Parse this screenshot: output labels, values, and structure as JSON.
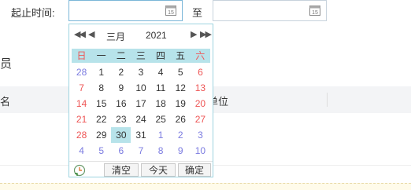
{
  "range_label": "起止时间:",
  "to_label": "至",
  "behind": {
    "section_text": "员",
    "col1": "名",
    "col2": "单位"
  },
  "calendar": {
    "nav_prev_year": "◀◀",
    "nav_prev_month": "◀",
    "nav_next_month": "▶",
    "nav_next_year": "▶▶",
    "month": "三月",
    "year": "2021",
    "weekdays": [
      "日",
      "一",
      "二",
      "三",
      "四",
      "五",
      "六"
    ],
    "days": [
      {
        "t": "28",
        "c": "other"
      },
      {
        "t": "1",
        "c": ""
      },
      {
        "t": "2",
        "c": ""
      },
      {
        "t": "3",
        "c": ""
      },
      {
        "t": "4",
        "c": ""
      },
      {
        "t": "5",
        "c": ""
      },
      {
        "t": "6",
        "c": "red"
      },
      {
        "t": "7",
        "c": "red"
      },
      {
        "t": "8",
        "c": ""
      },
      {
        "t": "9",
        "c": ""
      },
      {
        "t": "10",
        "c": ""
      },
      {
        "t": "11",
        "c": ""
      },
      {
        "t": "12",
        "c": ""
      },
      {
        "t": "13",
        "c": "red"
      },
      {
        "t": "14",
        "c": "red"
      },
      {
        "t": "15",
        "c": ""
      },
      {
        "t": "16",
        "c": ""
      },
      {
        "t": "17",
        "c": ""
      },
      {
        "t": "18",
        "c": ""
      },
      {
        "t": "19",
        "c": ""
      },
      {
        "t": "20",
        "c": "red"
      },
      {
        "t": "21",
        "c": "red"
      },
      {
        "t": "22",
        "c": ""
      },
      {
        "t": "23",
        "c": ""
      },
      {
        "t": "24",
        "c": ""
      },
      {
        "t": "25",
        "c": ""
      },
      {
        "t": "26",
        "c": ""
      },
      {
        "t": "27",
        "c": "red"
      },
      {
        "t": "28",
        "c": "red"
      },
      {
        "t": "29",
        "c": ""
      },
      {
        "t": "30",
        "c": "sel"
      },
      {
        "t": "31",
        "c": ""
      },
      {
        "t": "1",
        "c": "other"
      },
      {
        "t": "2",
        "c": "other"
      },
      {
        "t": "3",
        "c": "other"
      },
      {
        "t": "4",
        "c": "other"
      },
      {
        "t": "5",
        "c": "other"
      },
      {
        "t": "6",
        "c": "other"
      },
      {
        "t": "7",
        "c": "other"
      },
      {
        "t": "8",
        "c": "other"
      },
      {
        "t": "9",
        "c": "other"
      },
      {
        "t": "10",
        "c": "other"
      }
    ],
    "buttons": {
      "clear": "清空",
      "today": "今天",
      "ok": "确定"
    }
  },
  "icons": {
    "input_calendar": "calendar-icon",
    "time_toggle": "clock-icon"
  },
  "colors": {
    "accent": "#b7e3ea",
    "weekend": "#e55555",
    "other_month": "#7b7be0",
    "border_active": "#7ab6d8"
  }
}
